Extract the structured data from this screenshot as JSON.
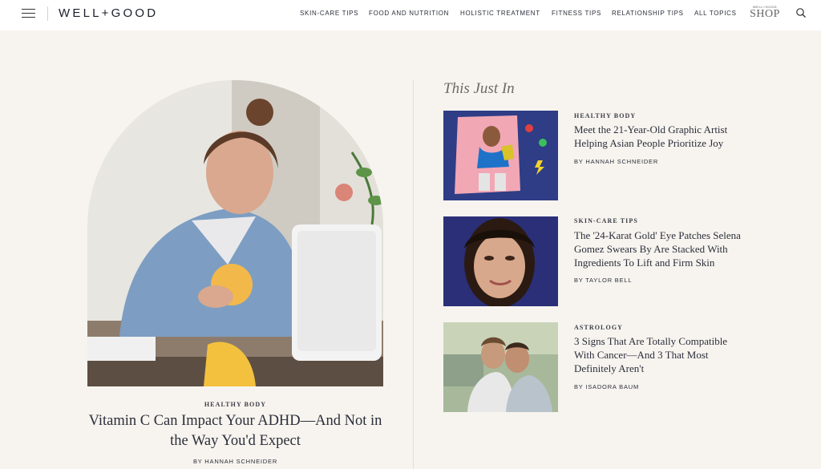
{
  "header": {
    "logo": "WELL+GOOD",
    "nav": [
      {
        "label": "SKIN-CARE TIPS"
      },
      {
        "label": "FOOD AND NUTRITION"
      },
      {
        "label": "HOLISTIC TREATMENT"
      },
      {
        "label": "FITNESS TIPS"
      },
      {
        "label": "RELATIONSHIP TIPS"
      },
      {
        "label": "ALL TOPICS"
      }
    ],
    "shop_small": "WELL+GOOD",
    "shop": "SHOP",
    "menu_icon": "hamburger-icon",
    "search_icon": "search-icon"
  },
  "hero": {
    "category": "HEALTHY BODY",
    "title": "Vitamin C Can Impact Your ADHD—And Not in the Way You'd Expect",
    "byline": "BY HANNAH SCHNEIDER"
  },
  "just_in": {
    "title": "This Just In",
    "cards": [
      {
        "category": "HEALTHY BODY",
        "title": "Meet the 21-Year-Old Graphic Artist Helping Asian People Prioritize Joy",
        "byline": "BY HANNAH SCHNEIDER"
      },
      {
        "category": "SKIN-CARE TIPS",
        "title": "The '24-Karat Gold' Eye Patches Selena Gomez Swears By Are Stacked With Ingredients To Lift and Firm Skin",
        "byline": "BY TAYLOR BELL"
      },
      {
        "category": "ASTROLOGY",
        "title": "3 Signs That Are Totally Compatible With Cancer—And 3 That Most Definitely Aren't",
        "byline": "BY ISADORA BAUM"
      }
    ]
  },
  "colors": {
    "background": "#f7f4ef",
    "header": "#ffffff",
    "text": "#2b2e3a",
    "section_title": "#6b6a64"
  }
}
